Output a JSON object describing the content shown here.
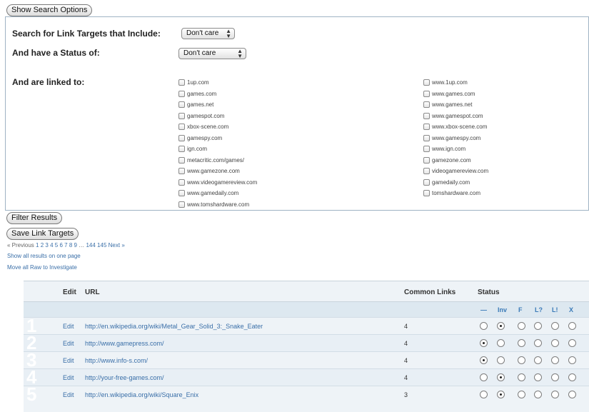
{
  "buttons": {
    "show_search_options": "Show Search Options",
    "filter_results": "Filter Results",
    "save_link_targets": "Save Link Targets"
  },
  "search": {
    "include_label": "Search for Link Targets that Include:",
    "include_value": "Don't care",
    "status_label": "And have a Status of:",
    "status_value": "Don't care",
    "linked_label": "And are linked to:",
    "sites_left": [
      {
        "label": "1up.com",
        "checked": false
      },
      {
        "label": "games.com",
        "checked": false
      },
      {
        "label": "games.net",
        "checked": false
      },
      {
        "label": "gamespot.com",
        "checked": false
      },
      {
        "label": "xbox-scene.com",
        "checked": false
      },
      {
        "label": "gamespy.com",
        "checked": false
      },
      {
        "label": "ign.com",
        "checked": false
      },
      {
        "label": "metacritic.com/games/",
        "checked": false
      },
      {
        "label": "www.gamezone.com",
        "checked": false
      },
      {
        "label": "www.videogamereview.com",
        "checked": false
      },
      {
        "label": "www.gamedaily.com",
        "checked": false
      },
      {
        "label": "www.tomshardware.com",
        "checked": false
      }
    ],
    "sites_right": [
      {
        "label": "www.1up.com",
        "checked": false
      },
      {
        "label": "www.games.com",
        "checked": false
      },
      {
        "label": "www.games.net",
        "checked": false
      },
      {
        "label": "www.gamespot.com",
        "checked": false
      },
      {
        "label": "www.xbox-scene.com",
        "checked": false
      },
      {
        "label": "www.gamespy.com",
        "checked": false
      },
      {
        "label": "www.ign.com",
        "checked": false
      },
      {
        "label": "gamezone.com",
        "checked": false
      },
      {
        "label": "videogamereview.com",
        "checked": false
      },
      {
        "label": "gamedaily.com",
        "checked": false
      },
      {
        "label": "tomshardware.com",
        "checked": false
      }
    ]
  },
  "pagination": {
    "previous": "« Previous",
    "pages": [
      "1",
      "2",
      "3",
      "4",
      "5",
      "6",
      "7",
      "8",
      "9"
    ],
    "ellipsis": "…",
    "last_pages": [
      "144",
      "145"
    ],
    "next": "Next »"
  },
  "actions": {
    "show_all": "Show all results on one page",
    "move_all": "Move all Raw to Investigate"
  },
  "table": {
    "headers": {
      "edit": "Edit",
      "url": "URL",
      "common_links": "Common Links",
      "status": "Status"
    },
    "status_columns": [
      "—",
      "Inv",
      "F",
      "L?",
      "L!",
      "X"
    ],
    "rows": [
      {
        "num": "1",
        "edit": "Edit",
        "url": "http://en.wikipedia.org/wiki/Metal_Gear_Solid_3:_Snake_Eater",
        "common_links": "4",
        "status_index": 1
      },
      {
        "num": "2",
        "edit": "Edit",
        "url": "http://www.gamepress.com/",
        "common_links": "4",
        "status_index": 0
      },
      {
        "num": "3",
        "edit": "Edit",
        "url": "http://www.info-s.com/",
        "common_links": "4",
        "status_index": 0
      },
      {
        "num": "4",
        "edit": "Edit",
        "url": "http://your-free-games.com/",
        "common_links": "4",
        "status_index": 1
      },
      {
        "num": "5",
        "edit": "Edit",
        "url": "http://en.wikipedia.org/wiki/Square_Enix",
        "common_links": "3",
        "status_index": 1
      }
    ]
  }
}
